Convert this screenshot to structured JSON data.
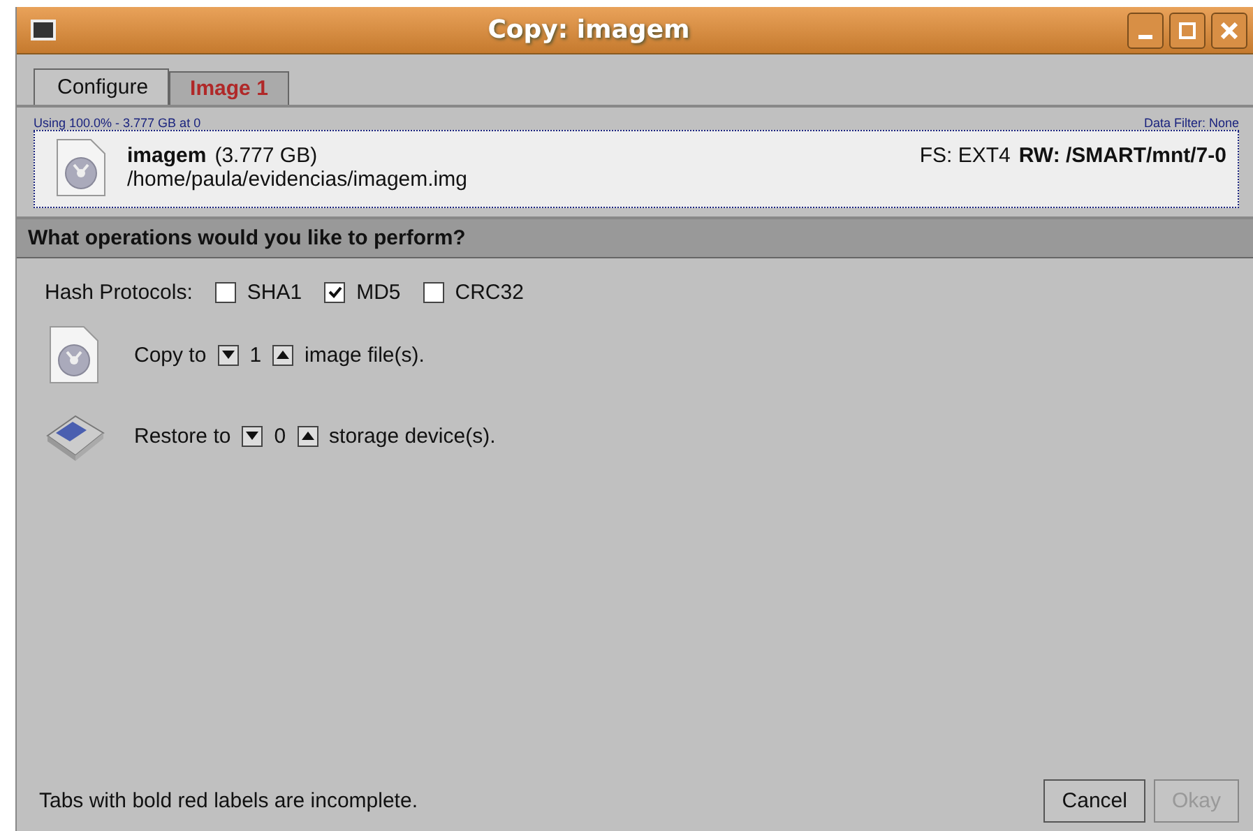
{
  "window": {
    "title": "Copy: imagem"
  },
  "tabs": [
    {
      "label": "Configure",
      "selected": true,
      "incomplete": false
    },
    {
      "label": "Image 1",
      "selected": false,
      "incomplete": true
    }
  ],
  "source": {
    "usage": "Using 100.0% - 3.777 GB at 0",
    "data_filter": "Data Filter: None",
    "name": "imagem",
    "size": "(3.777 GB)",
    "path": "/home/paula/evidencias/imagem.img",
    "fs": "FS: EXT4",
    "rw": "RW: /SMART/mnt/7-0"
  },
  "section_title": "What operations would you like to perform?",
  "hash": {
    "label": "Hash Protocols:",
    "options": [
      {
        "label": "SHA1",
        "checked": false
      },
      {
        "label": "MD5",
        "checked": true
      },
      {
        "label": "CRC32",
        "checked": false
      }
    ]
  },
  "operations": [
    {
      "kind": "image",
      "label": "Copy to",
      "count": "1",
      "suffix": "image file(s)."
    },
    {
      "kind": "disk",
      "label": "Restore to",
      "count": "0",
      "suffix": "storage device(s)."
    }
  ],
  "footer_note": "Tabs with bold red labels are incomplete.",
  "buttons": [
    {
      "label": "Cancel",
      "disabled": false
    },
    {
      "label": "Okay",
      "disabled": true
    }
  ]
}
